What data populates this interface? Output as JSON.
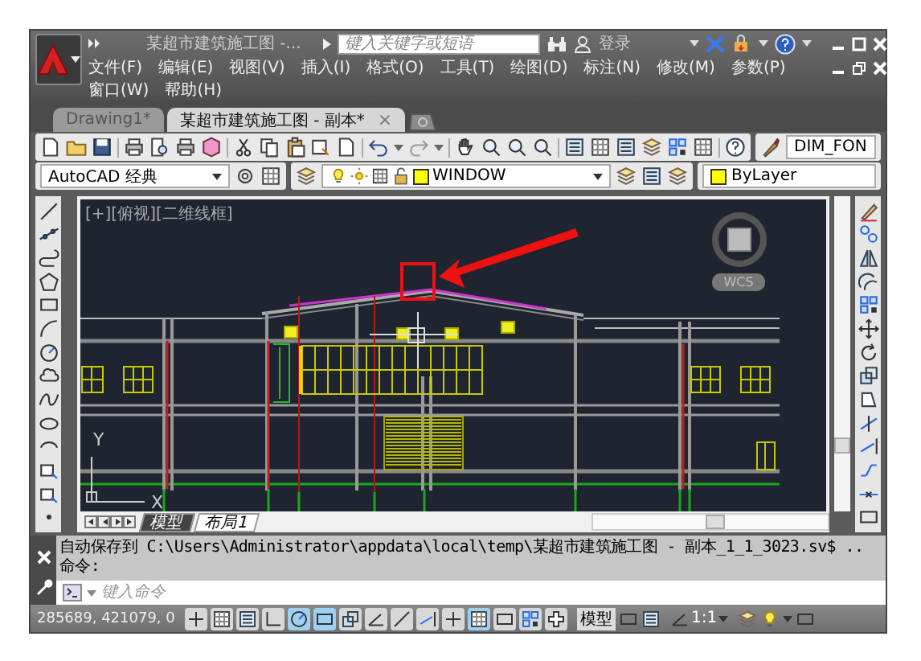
{
  "title_bar": {
    "title": "某超市建筑施工图 -...",
    "search_placeholder": "键入关键字或短语",
    "sign_in": "登录"
  },
  "menu_rows": [
    [
      "文件(F)",
      "编辑(E)",
      "视图(V)",
      "插入(I)",
      "格式(O)",
      "工具(T)",
      "绘图(D)",
      "标注(N)",
      "修改(M)",
      "参数(P)"
    ],
    [
      "窗口(W)",
      "帮助(H)"
    ]
  ],
  "document_tabs": [
    {
      "label": "Drawing1*",
      "selected": false
    },
    {
      "label": "某超市建筑施工图 - 副本*",
      "selected": true,
      "close": "×"
    }
  ],
  "toolbar": {
    "text_style": "DIM_FON",
    "workspace": "AutoCAD 经典",
    "layer": "WINDOW",
    "color_control": "ByLayer"
  },
  "viewport": {
    "label": "[+][俯视][二维线框]",
    "coordinate_system": "WCS",
    "y_axis": "Y",
    "x_axis": "X"
  },
  "layout_tabs": [
    {
      "label": "模型",
      "selected": true
    },
    {
      "label": "布局1",
      "selected": false
    }
  ],
  "command_history": [
    "自动保存到 C:\\Users\\Administrator\\appdata\\local\\temp\\某超市建筑施工图 - 副本_1_1_3023.sv$ ..",
    "命令:"
  ],
  "command_placeholder": "键入命令",
  "status_bar": {
    "coordinates": "285689, 421079, 0",
    "toggles": [
      {
        "on": false
      },
      {
        "on": false
      },
      {
        "on": false
      },
      {
        "on": false
      },
      {
        "on": true
      },
      {
        "on": true
      },
      {
        "on": false
      },
      {
        "on": false
      },
      {
        "on": false
      },
      {
        "on": false
      },
      {
        "on": false
      },
      {
        "on": true
      },
      {
        "on": false
      },
      {
        "on": false
      },
      {
        "on": false
      }
    ],
    "model": "模型",
    "scale": "1:1"
  }
}
